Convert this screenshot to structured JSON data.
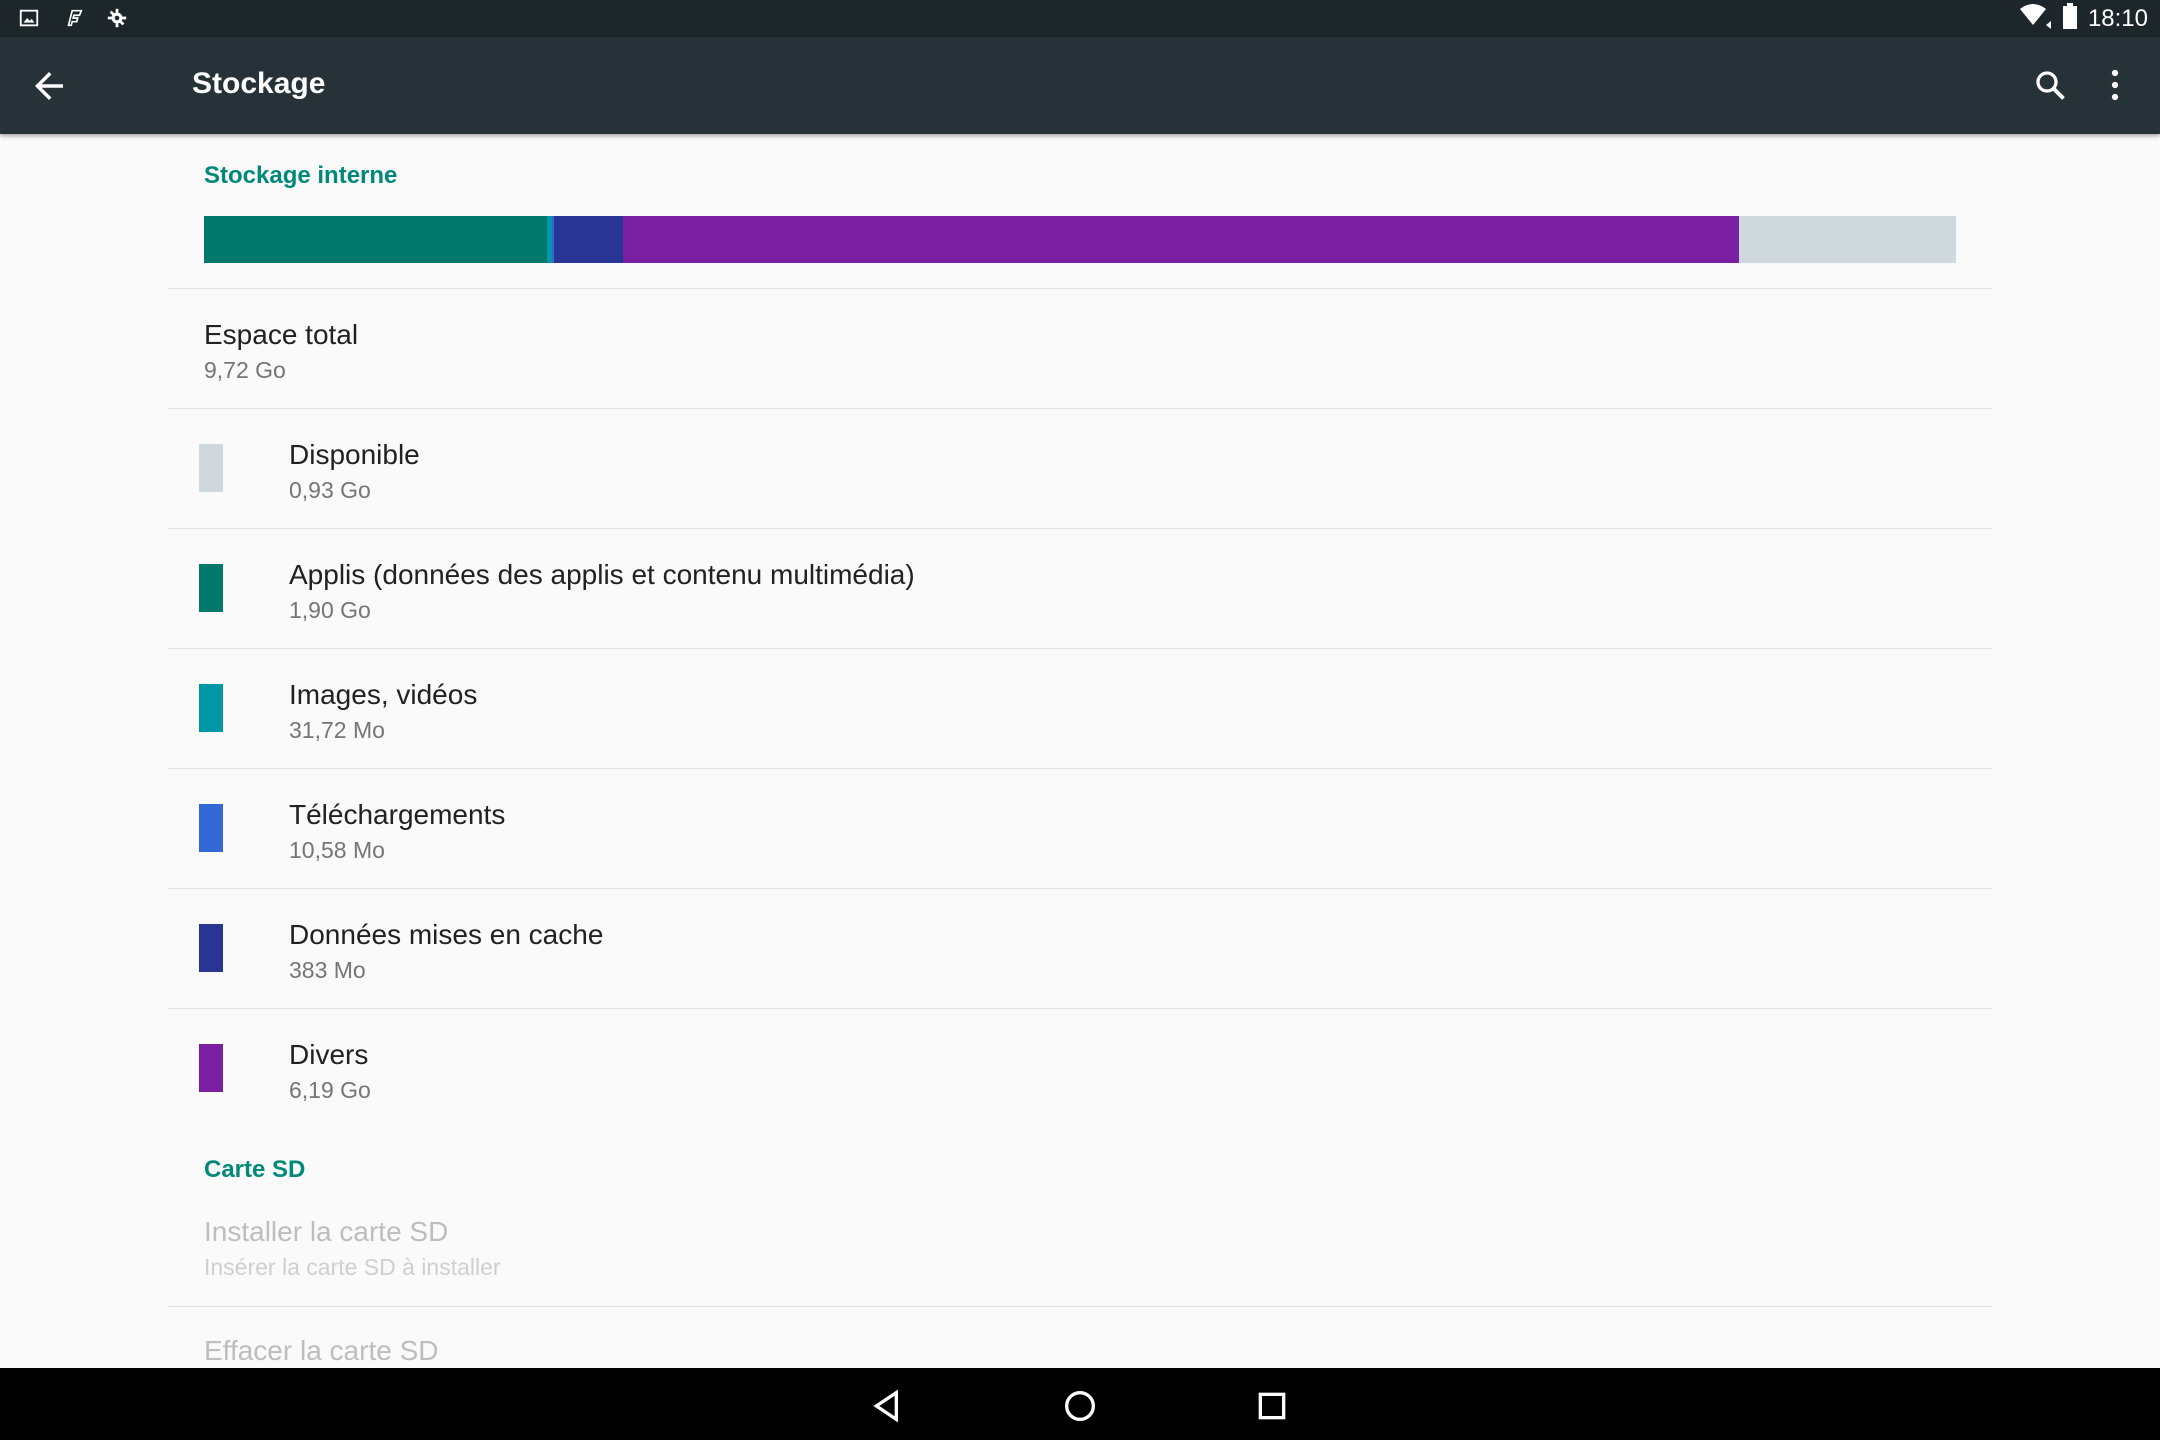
{
  "status_bar": {
    "time": "18:10",
    "left_icons": [
      "image-icon",
      "flipboard-icon",
      "settings-gear-icon"
    ],
    "right_icons": [
      "wifi-icon",
      "battery-icon"
    ]
  },
  "toolbar": {
    "title": "Stockage",
    "back_icon": "arrow-back-icon",
    "search_icon": "search-icon",
    "more_icon": "more-vert-icon"
  },
  "internal": {
    "header": "Stockage interne",
    "usage_bar": [
      {
        "category": "Applis",
        "color": "#00796b",
        "fraction": 0.1955
      },
      {
        "category": "Images, vidéos",
        "color": "#0097a7",
        "fraction": 0.0033
      },
      {
        "category": "Téléchargements",
        "color": "#3367d6",
        "fraction": 0.0011
      },
      {
        "category": "Données mises en cache",
        "color": "#283593",
        "fraction": 0.0394
      },
      {
        "category": "Divers",
        "color": "#7b1fa2",
        "fraction": 0.6368
      },
      {
        "category": "Disponible",
        "color": "#cfd8dc",
        "fraction": 0.1239
      }
    ],
    "total": {
      "title": "Espace total",
      "value": "9,72 Go"
    },
    "items": [
      {
        "title": "Disponible",
        "value": "0,93 Go",
        "color": "#cfd8dc"
      },
      {
        "title": "Applis (données des applis et contenu multimédia)",
        "value": "1,90 Go",
        "color": "#00796b"
      },
      {
        "title": "Images, vidéos",
        "value": "31,72 Mo",
        "color": "#0097a7"
      },
      {
        "title": "Téléchargements",
        "value": "10,58 Mo",
        "color": "#3367d6"
      },
      {
        "title": "Données mises en cache",
        "value": "383 Mo",
        "color": "#283593"
      },
      {
        "title": "Divers",
        "value": "6,19 Go",
        "color": "#7b1fa2"
      }
    ]
  },
  "sd": {
    "header": "Carte SD",
    "install": {
      "title": "Installer la carte SD",
      "subtitle": "Insérer la carte SD à installer"
    },
    "erase": {
      "title": "Effacer la carte SD"
    }
  },
  "nav_bar": {
    "icons": [
      "nav-back-icon",
      "nav-home-icon",
      "nav-recents-icon"
    ]
  },
  "colors": {
    "accent": "#00897b",
    "toolbar": "#263238",
    "status_bar": "#1c262b"
  }
}
